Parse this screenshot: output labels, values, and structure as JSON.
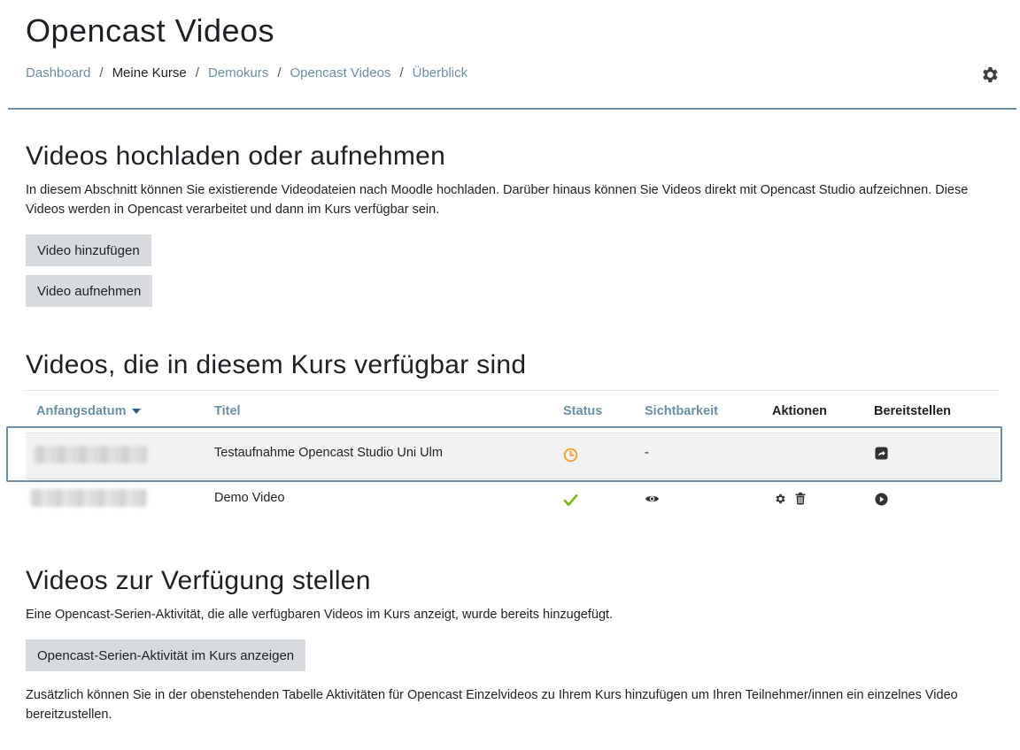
{
  "page": {
    "title": "Opencast Videos"
  },
  "breadcrumb": [
    {
      "label": "Dashboard"
    },
    {
      "label": "Meine Kurse"
    },
    {
      "label": "Demokurs"
    },
    {
      "label": "Opencast Videos"
    },
    {
      "label": "Überblick"
    }
  ],
  "breadcrumb_separator": "/",
  "settings_icon": "gear-icon",
  "upload_section": {
    "heading": "Videos hochladen oder aufnehmen",
    "description": "In diesem Abschnitt können Sie existierende Videodateien nach Moodle hochladen. Darüber hinaus können Sie Videos direkt mit Opencast Studio aufzeichnen. Diese Videos werden in Opencast verarbeitet und dann im Kurs verfügbar sein.",
    "add_button": "Video hinzufügen",
    "record_button": "Video aufnehmen"
  },
  "videos_section": {
    "heading": "Videos, die in diesem Kurs verfügbar sind",
    "columns": {
      "date": "Anfangsdatum",
      "title": "Titel",
      "status": "Status",
      "visibility": "Sichtbarkeit",
      "actions": "Aktionen",
      "provide": "Bereitstellen"
    },
    "sort_icon": "caret-down-icon",
    "rows": [
      {
        "date_hidden": true,
        "title": "Testaufnahme Opencast Studio Uni Ulm",
        "status_icon": "clock-icon",
        "visibility": "-",
        "actions": [],
        "provide_icon": "share-icon"
      },
      {
        "date_hidden": true,
        "title": "Demo Video",
        "status_icon": "checkmark-icon",
        "visibility_icon": "eye-icon",
        "actions": [
          "gear-icon",
          "trash-icon"
        ],
        "provide_icon": "play-circle-icon"
      }
    ]
  },
  "provide_section": {
    "heading": "Videos zur Verfügung stellen",
    "description": "Eine Opencast-Serien-Aktivität, die alle verfügbaren Videos im Kurs anzeigt, wurde bereits hinzugefügt.",
    "button": "Opencast-Serien-Aktivität im Kurs anzeigen",
    "note": "Zusätzlich können Sie in der obenstehenden Tabelle Aktivitäten für Opencast Einzelvideos zu Ihrem Kurs hinzufügen um Ihren Teilnehmer/innen ein einzelnes Video bereitzustellen."
  },
  "colors": {
    "link": "#6a8fa8",
    "accent_rule": "#6a8fa8",
    "button_bg": "#d8dbde",
    "status_pending": "#f0a030",
    "status_ok": "#7ab51d"
  }
}
